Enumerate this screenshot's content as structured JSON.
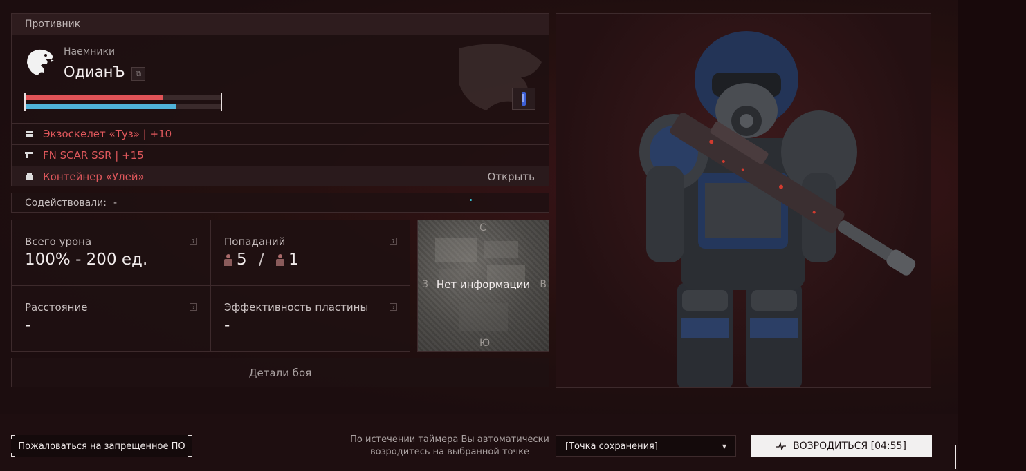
{
  "enemy": {
    "header": "Противник",
    "faction": "Наемники",
    "player_name": "ОдианЪ",
    "health_fraction": 0.7,
    "armor_fraction": 0.77,
    "health_color": "#e05357",
    "armor_color": "#4fb3d9",
    "equipment": [
      {
        "label": "Экзоскелет «Туз» | +10",
        "icon": "armor-icon"
      },
      {
        "label": "FN SCAR SSR | +15",
        "icon": "weapon-icon"
      },
      {
        "label": "Контейнер «Улей»",
        "icon": "container-icon",
        "action": "Открыть"
      }
    ]
  },
  "assist": {
    "label": "Содействовали:",
    "value": "-"
  },
  "stats": {
    "total_damage": {
      "label": "Всего урона",
      "value": "100% - 200 ед."
    },
    "hits": {
      "label": "Попаданий",
      "body": "5",
      "separator": "/",
      "head": "1"
    },
    "distance": {
      "label": "Расстояние",
      "value": "-"
    },
    "plate_efficiency": {
      "label": "Эффективность пластины",
      "value": "-"
    },
    "help_mark": "?"
  },
  "minimap": {
    "north": "С",
    "south": "Ю",
    "west": "З",
    "east": "В",
    "message": "Нет информации"
  },
  "details_button": "Детали боя",
  "bottom": {
    "report_button": "Пожаловаться на запрещенное ПО",
    "timer_note_line1": "По истечении таймера Вы автоматически",
    "timer_note_line2": "возродитесь на выбранной точке",
    "spawn_select": "[Точка сохранения]",
    "respawn_button": "ВОЗРОДИТЬСЯ [04:55]"
  }
}
